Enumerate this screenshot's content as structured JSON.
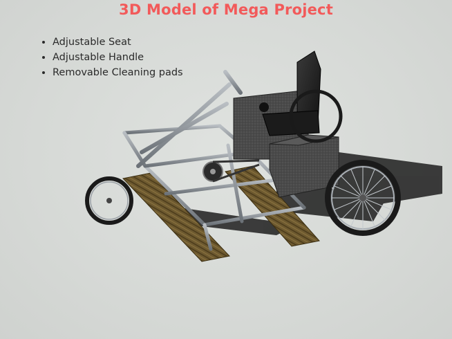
{
  "slide": {
    "title": "3D Model of Mega Project",
    "title_color": "#f25a5a",
    "features": [
      "Adjustable Seat",
      "Adjustable Handle",
      "Removable Cleaning pads"
    ]
  },
  "image": {
    "subject": "solar panel cleaning tricycle 3D model",
    "icon": "tricycle-render"
  }
}
